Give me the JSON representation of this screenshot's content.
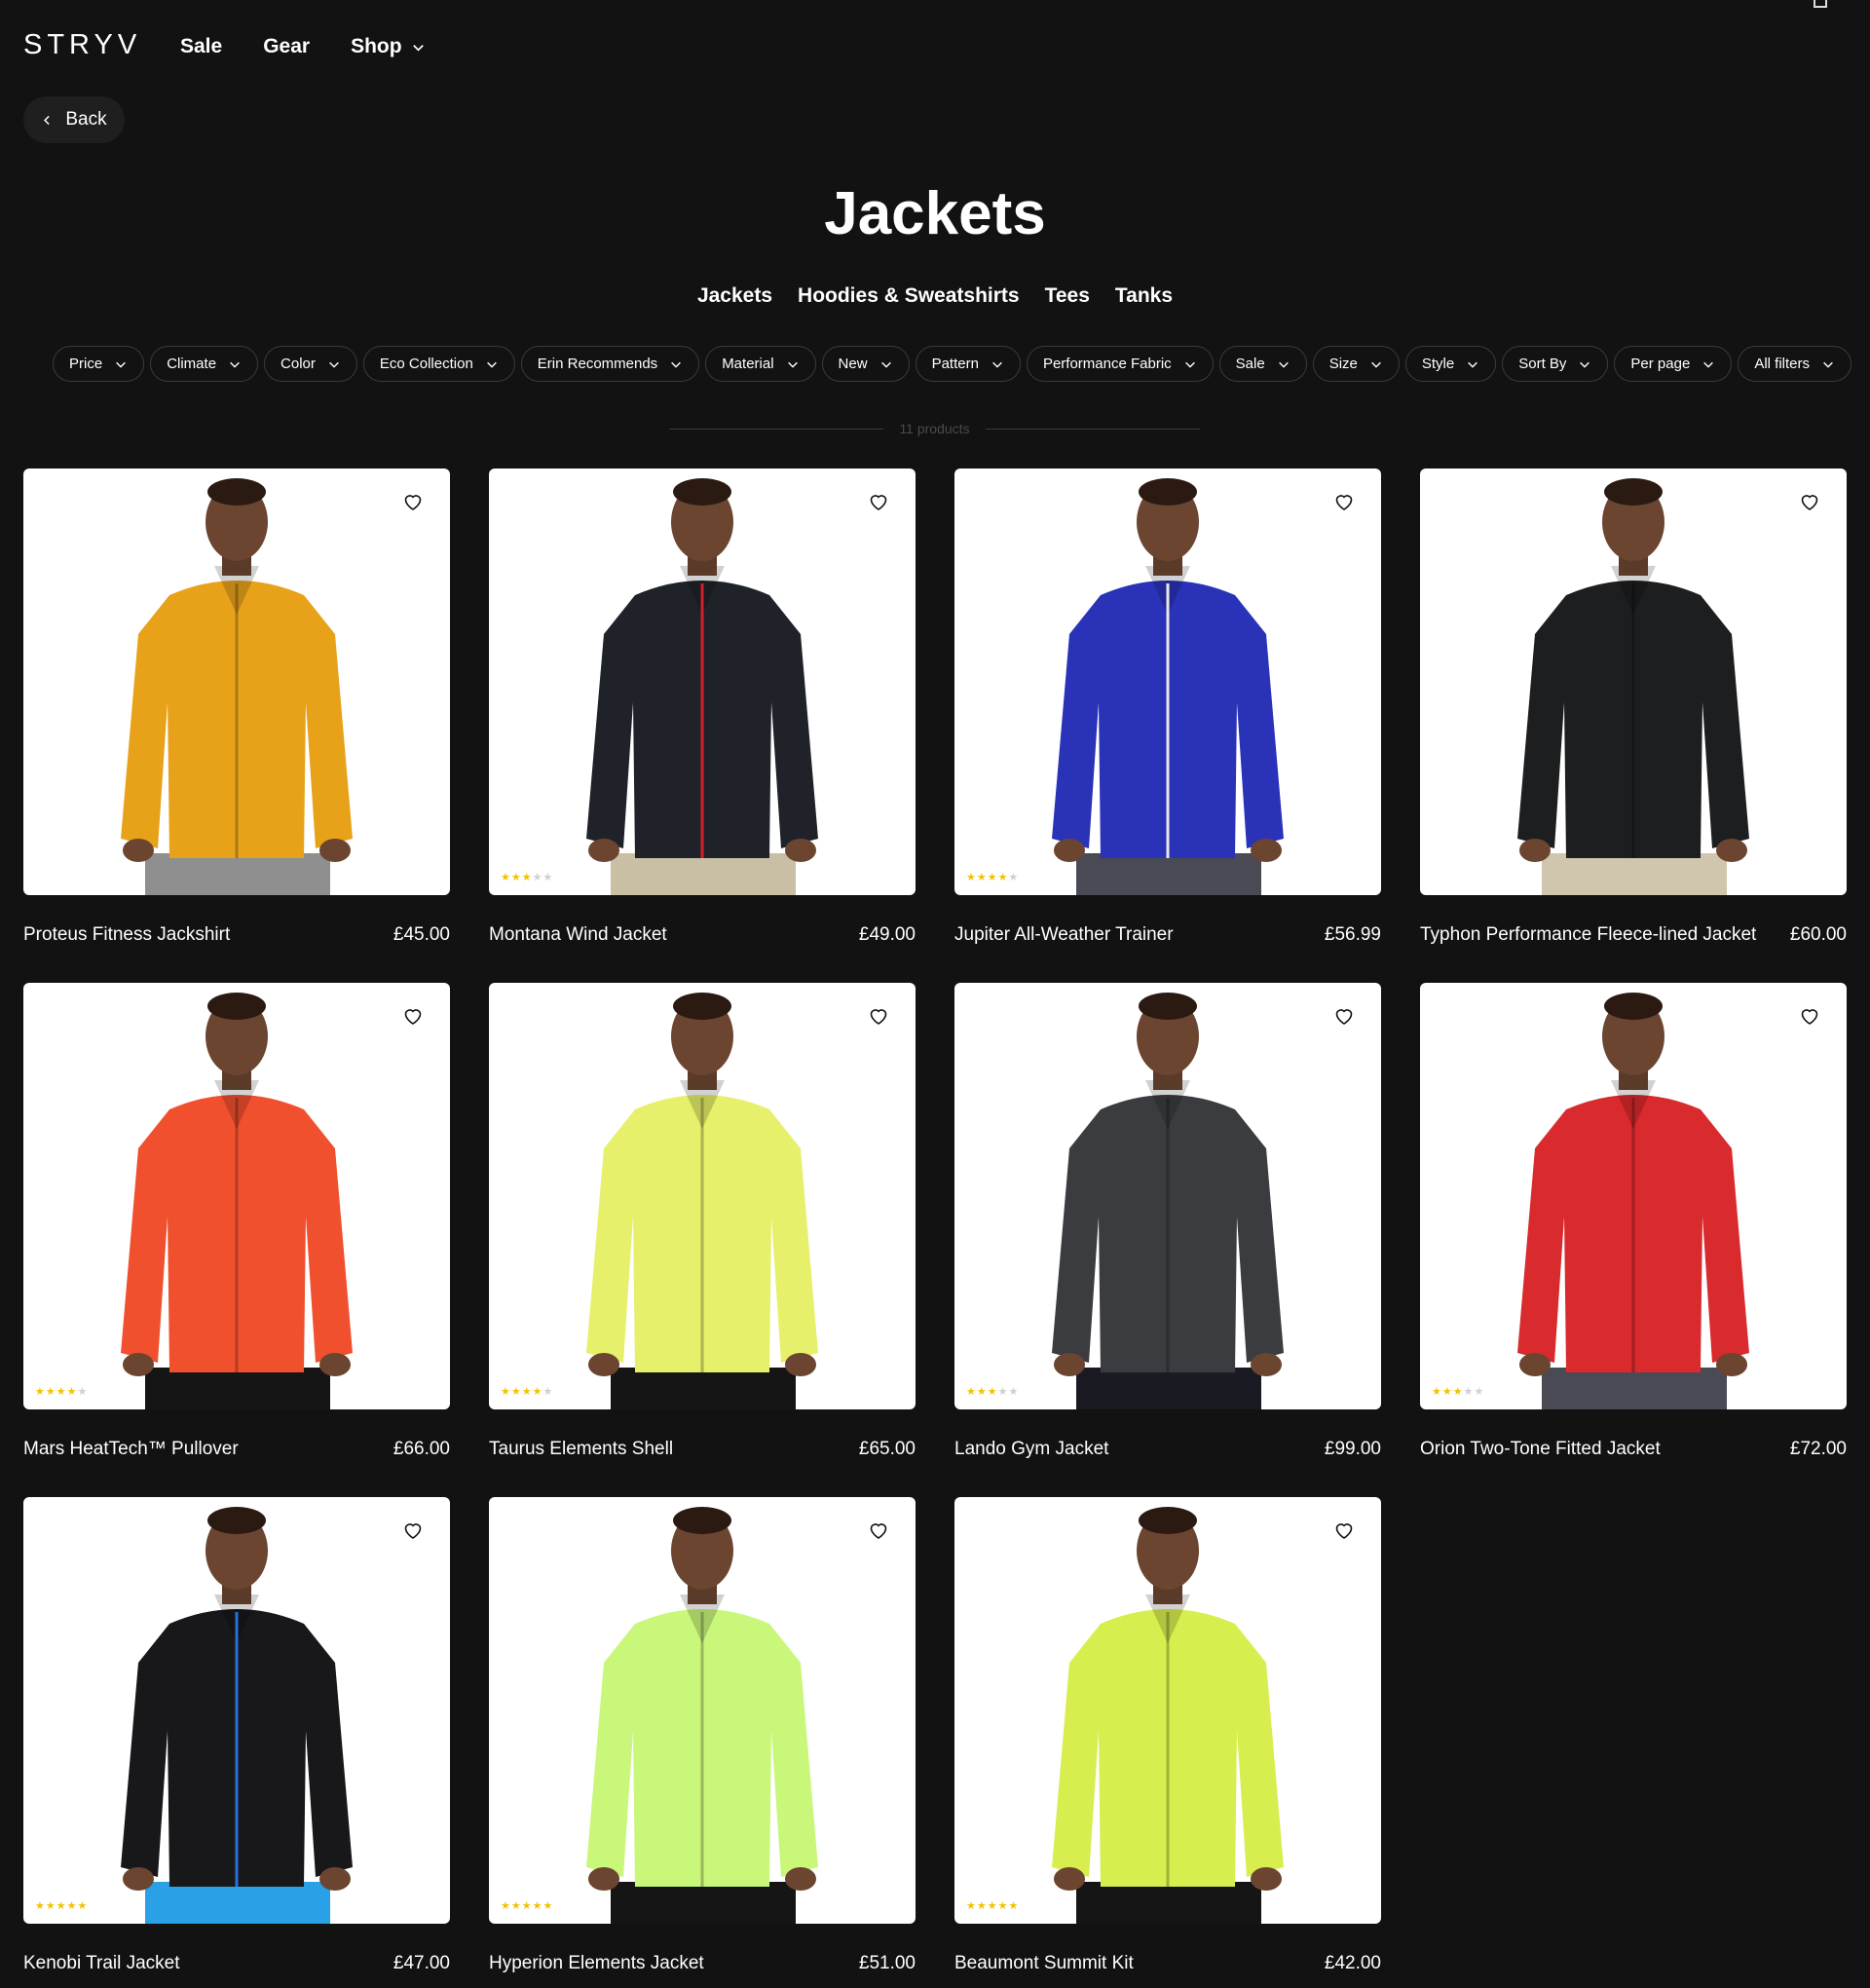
{
  "brand": "STRYV",
  "nav": {
    "sale": "Sale",
    "gear": "Gear",
    "shop": "Shop"
  },
  "back_label": "Back",
  "page_title": "Jackets",
  "subnav": [
    "Jackets",
    "Hoodies & Sweatshirts",
    "Tees",
    "Tanks"
  ],
  "filters": [
    "Price",
    "Climate",
    "Color",
    "Eco Collection",
    "Erin Recommends",
    "Material",
    "New",
    "Pattern",
    "Performance Fabric",
    "Sale",
    "Size",
    "Style",
    "Sort By",
    "Per page",
    "All filters"
  ],
  "product_count": "11 products",
  "icons": [
    "search-icon",
    "chat-icon",
    "heart-icon",
    "user-icon"
  ],
  "colors": {
    "background": "#121212",
    "star": "#f2c200"
  },
  "products": [
    {
      "name": "Proteus Fitness Jackshirt",
      "price": "£45.00",
      "rating": 0,
      "color": "#e8a21a",
      "pants": "#8f8f8f"
    },
    {
      "name": "Montana Wind Jacket",
      "price": "£49.00",
      "rating": 3,
      "color": "#1f2329",
      "pants": "#c9bfa5",
      "zip": "#d0202a"
    },
    {
      "name": "Jupiter All-Weather Trainer",
      "price": "£56.99",
      "rating": 4,
      "color": "#2a32b8",
      "pants": "#4a4a55",
      "zip": "#e8e8e8"
    },
    {
      "name": "Typhon Performance Fleece-lined Jacket",
      "price": "£60.00",
      "rating": 0,
      "color": "#1d1e20",
      "pants": "#cfc6ad"
    },
    {
      "name": "Mars HeatTech™ Pullover",
      "price": "£66.00",
      "rating": 4,
      "color": "#f0502e",
      "pants": "#151515"
    },
    {
      "name": "Taurus Elements Shell",
      "price": "£65.00",
      "rating": 3.5,
      "color": "#e6f06a",
      "pants": "#151515"
    },
    {
      "name": "Lando Gym Jacket",
      "price": "£99.00",
      "rating": 3,
      "color": "#3b3c3f",
      "pants": "#1a1a22"
    },
    {
      "name": "Orion Two-Tone Fitted Jacket",
      "price": "£72.00",
      "rating": 3,
      "color": "#d92a2e",
      "pants": "#4a4a55"
    },
    {
      "name": "Kenobi Trail Jacket",
      "price": "£47.00",
      "rating": 5,
      "color": "#18181b",
      "pants": "#2aa0e6",
      "zip": "#2a70d6"
    },
    {
      "name": "Hyperion Elements Jacket",
      "price": "£51.00",
      "rating": 4.5,
      "color": "#c9f77a",
      "pants": "#151515"
    },
    {
      "name": "Beaumont Summit Kit",
      "price": "£42.00",
      "rating": 4.5,
      "color": "#d8ee4e",
      "pants": "#151515"
    }
  ]
}
